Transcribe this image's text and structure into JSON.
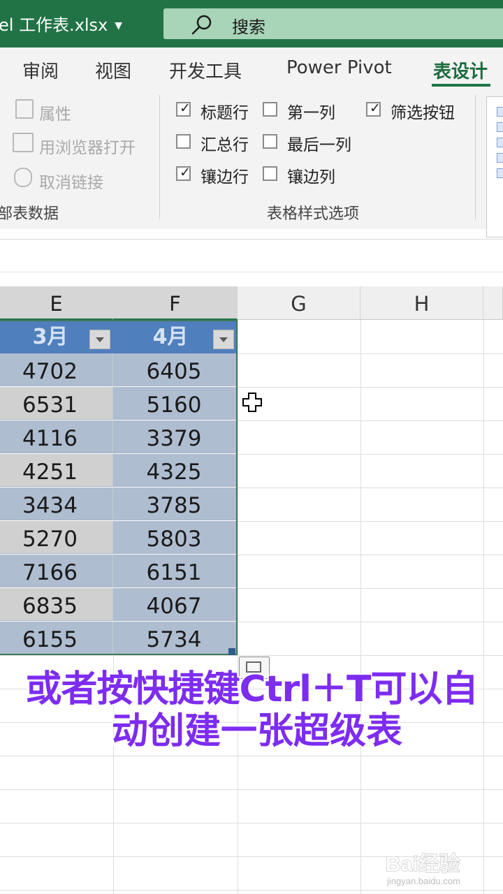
{
  "titlebar": {
    "file_name": "el 工作表.xlsx",
    "search_label": "搜索"
  },
  "ribbon": {
    "tabs": [
      {
        "label": "审阅"
      },
      {
        "label": "视图"
      },
      {
        "label": "开发工具"
      },
      {
        "label": "Power Pivot"
      },
      {
        "label": "表设计",
        "active": true
      }
    ],
    "external_group": {
      "label": "部表数据",
      "items": [
        {
          "label": "属性",
          "icon": "properties-icon",
          "enabled": false
        },
        {
          "label": "用浏览器打开",
          "icon": "open-in-browser-icon",
          "enabled": false
        },
        {
          "label": "取消链接",
          "icon": "unlink-icon",
          "enabled": false
        }
      ]
    },
    "style_options_group": {
      "label": "表格样式选项",
      "options": [
        {
          "label": "标题行",
          "checked": true
        },
        {
          "label": "第一列",
          "checked": false
        },
        {
          "label": "筛选按钮",
          "checked": true
        },
        {
          "label": "汇总行",
          "checked": false
        },
        {
          "label": "最后一列",
          "checked": false
        },
        {
          "label": "镶边行",
          "checked": true
        },
        {
          "label": "镶边列",
          "checked": false
        }
      ]
    }
  },
  "sheet": {
    "columns": [
      "E",
      "F",
      "G",
      "H"
    ],
    "table": {
      "headers": [
        "3月",
        "4月"
      ],
      "rows": [
        [
          "4702",
          "6405"
        ],
        [
          "6531",
          "5160"
        ],
        [
          "4116",
          "3379"
        ],
        [
          "4251",
          "4325"
        ],
        [
          "3434",
          "3785"
        ],
        [
          "5270",
          "5803"
        ],
        [
          "7166",
          "6151"
        ],
        [
          "6835",
          "4067"
        ],
        [
          "6155",
          "5734"
        ]
      ]
    }
  },
  "caption": {
    "line1": "或者按快捷键Ctrl＋T可以自",
    "line2": "动创建一张超级表"
  },
  "watermark": {
    "brand": "Bai经验",
    "url": "jingyan.baidu.com"
  },
  "colors": {
    "excel_green": "#217346",
    "table_header": "#4f7fbd",
    "band_dark": "#aebdd0",
    "band_light": "#d0d0d0",
    "caption": "#7d2cf0"
  }
}
